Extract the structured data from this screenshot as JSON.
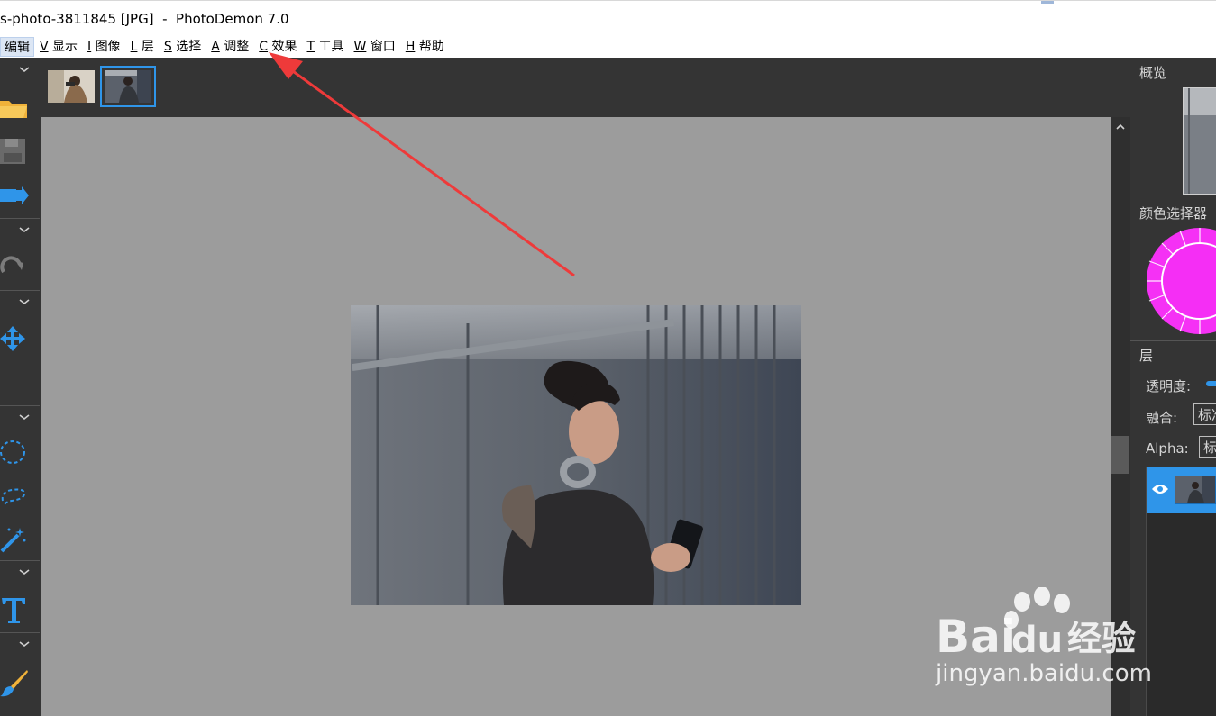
{
  "window": {
    "title": "s-photo-3811845 [JPG]  -  PhotoDemon 7.0"
  },
  "menu": [
    {
      "accel": "",
      "label": "编辑"
    },
    {
      "accel": "V",
      "label": "显示"
    },
    {
      "accel": "I",
      "label": "图像"
    },
    {
      "accel": "L",
      "label": "层"
    },
    {
      "accel": "S",
      "label": "选择"
    },
    {
      "accel": "A",
      "label": "调整"
    },
    {
      "accel": "C",
      "label": "效果"
    },
    {
      "accel": "T",
      "label": "工具"
    },
    {
      "accel": "W",
      "label": "窗口"
    },
    {
      "accel": "H",
      "label": "帮助"
    }
  ],
  "right_panel": {
    "overview_label": "概览",
    "color_picker_label": "颜色选择器",
    "layers_label": "层",
    "opacity_label": "透明度:",
    "blend_label": "融合:",
    "blend_value": "标准",
    "alpha_label": "Alpha:",
    "alpha_value": "标准"
  },
  "colors": {
    "accent": "#2f95e9",
    "color_wheel": "#f531f5",
    "annotation_arrow": "#ee3a3a"
  },
  "watermark": {
    "brand": "Bai",
    "brand_tail": "du",
    "cn": "经验",
    "url": "jingyan.baidu.com"
  }
}
